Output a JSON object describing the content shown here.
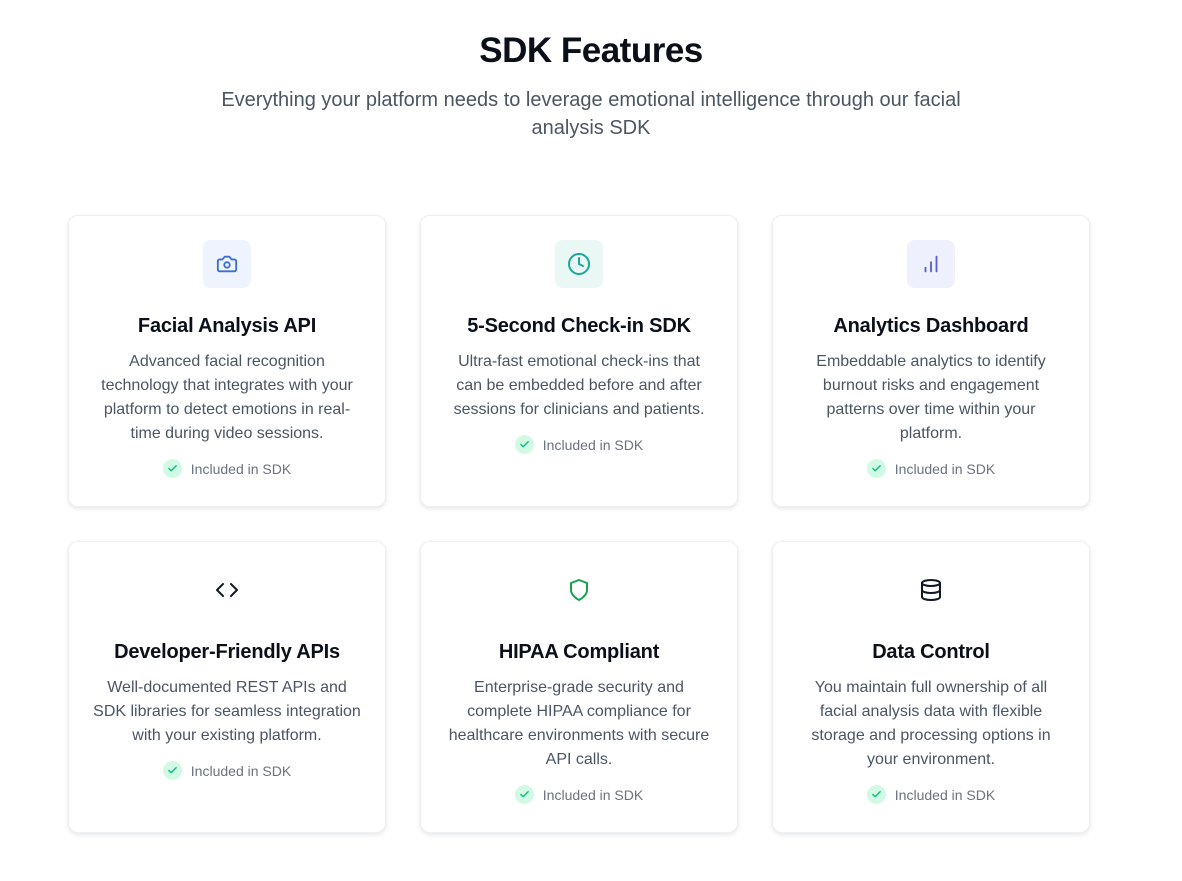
{
  "header": {
    "title": "SDK Features",
    "subtitle": "Everything your platform needs to leverage emotional intelligence through our facial analysis SDK"
  },
  "colors": {
    "check_bg": "#d1fae5",
    "check_mark": "#10b981",
    "camera_icon": "#3b6fd4",
    "camera_bg": "#eef3fd",
    "clock_icon": "#1aa89a",
    "clock_bg": "#e9f8f5",
    "chart_icon": "#5b5fc7",
    "chart_bg": "#eef0fd",
    "shield_icon": "#16a34a"
  },
  "features": [
    {
      "icon": "camera-icon",
      "title": "Facial Analysis API",
      "description": "Advanced facial recognition technology that integrates with your platform to detect emotions in real-time during video sessions.",
      "badge": "Included in SDK"
    },
    {
      "icon": "clock-icon",
      "title": "5-Second Check-in SDK",
      "description": "Ultra-fast emotional check-ins that can be embedded before and after sessions for clinicians and patients.",
      "badge": "Included in SDK"
    },
    {
      "icon": "bar-chart-icon",
      "title": "Analytics Dashboard",
      "description": "Embeddable analytics to identify burnout risks and engagement patterns over time within your platform.",
      "badge": "Included in SDK"
    },
    {
      "icon": "code-icon",
      "title": "Developer-Friendly APIs",
      "description": "Well-documented REST APIs and SDK libraries for seamless integration with your existing platform.",
      "badge": "Included in SDK"
    },
    {
      "icon": "shield-icon",
      "title": "HIPAA Compliant",
      "description": "Enterprise-grade security and complete HIPAA compliance for healthcare environments with secure API calls.",
      "badge": "Included in SDK"
    },
    {
      "icon": "database-icon",
      "title": "Data Control",
      "description": "You maintain full ownership of all facial analysis data with flexible storage and processing options in your environment.",
      "badge": "Included in SDK"
    }
  ]
}
